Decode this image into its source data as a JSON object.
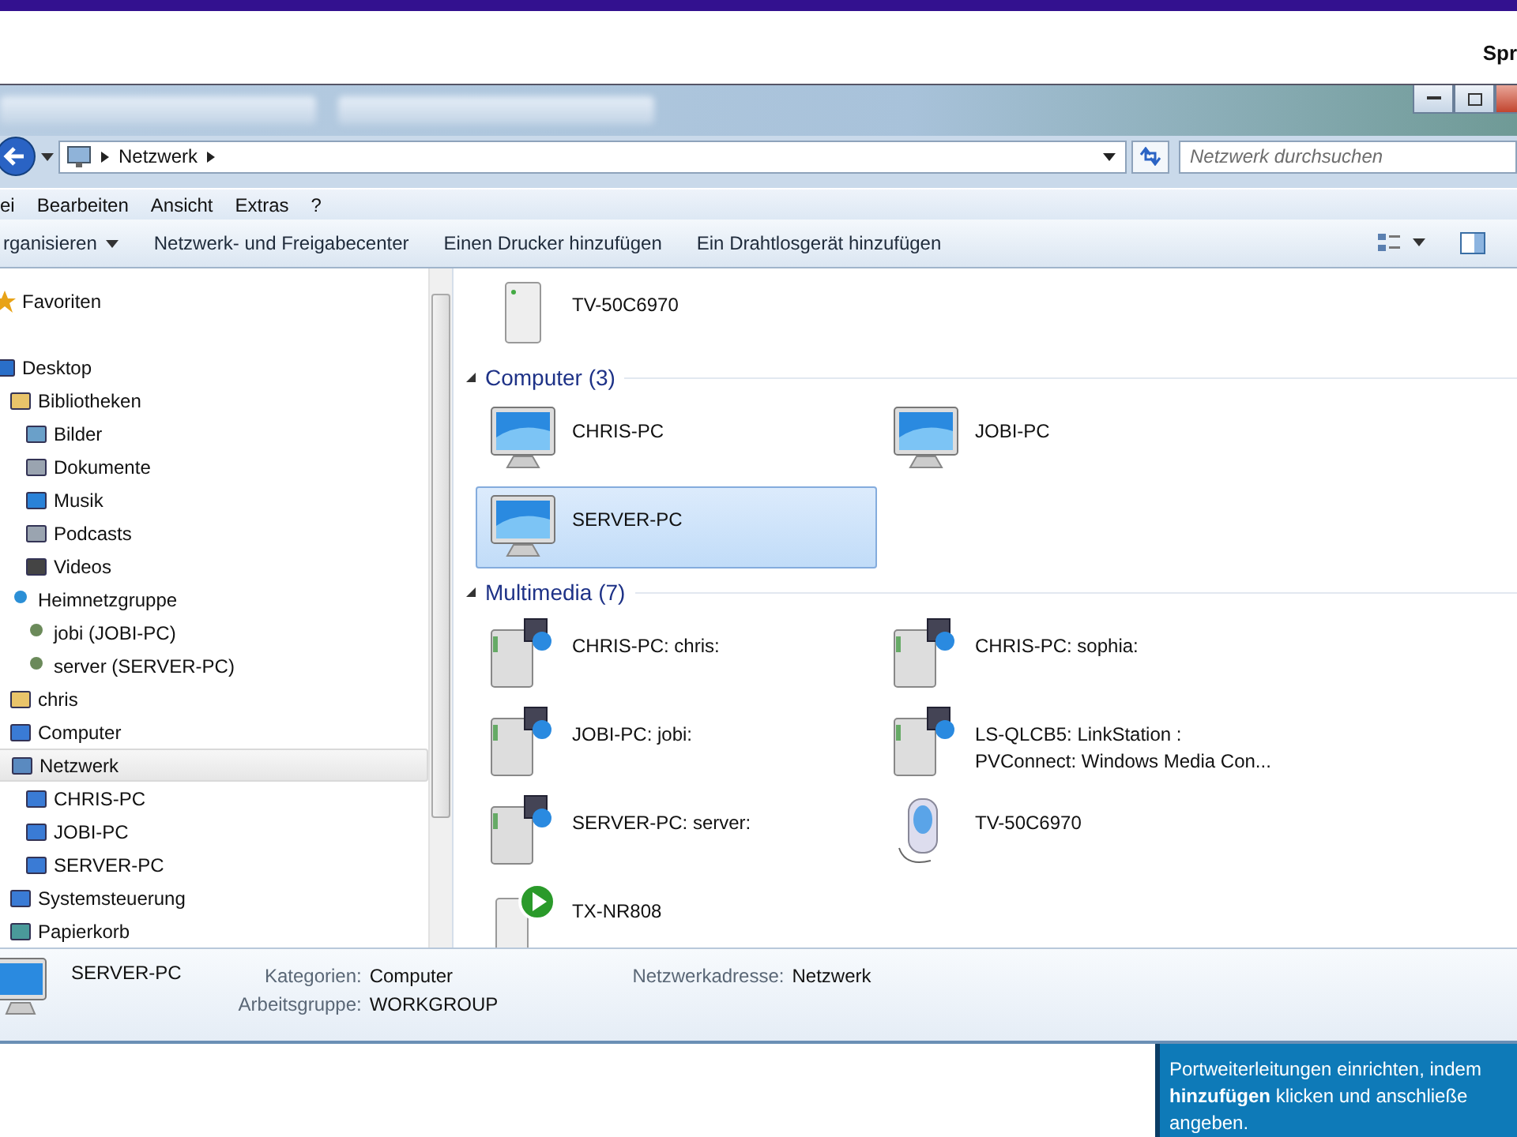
{
  "top_bar": {
    "text": "Spr"
  },
  "address": {
    "crumbs": [
      "Netzwerk"
    ],
    "search": {
      "placeholder": "Netzwerk durchsuchen"
    }
  },
  "menu": [
    "ei",
    "Bearbeiten",
    "Ansicht",
    "Extras",
    "?"
  ],
  "toolbar": [
    {
      "label": "rganisieren",
      "dropdown": true
    },
    {
      "label": "Netzwerk- und Freigabecenter",
      "dropdown": false
    },
    {
      "label": "Einen Drucker hinzufügen",
      "dropdown": false
    },
    {
      "label": "Ein Drahtlosgerät hinzufügen",
      "dropdown": false
    }
  ],
  "sidebar": {
    "items": [
      {
        "label": "Favoriten",
        "kind": "star",
        "selected": false
      },
      {
        "label": "Desktop",
        "kind": "desktop",
        "selected": false,
        "children": [
          {
            "label": "Bibliotheken",
            "kind": "folder",
            "selected": false,
            "children": [
              {
                "label": "Bilder",
                "kind": "picture",
                "selected": false
              },
              {
                "label": "Dokumente",
                "kind": "document",
                "selected": false
              },
              {
                "label": "Musik",
                "kind": "music",
                "selected": false
              },
              {
                "label": "Podcasts",
                "kind": "document",
                "selected": false
              },
              {
                "label": "Videos",
                "kind": "video",
                "selected": false
              }
            ]
          },
          {
            "label": "Heimnetzgruppe",
            "kind": "homegroup",
            "selected": false,
            "children": [
              {
                "label": "jobi (JOBI-PC)",
                "kind": "user",
                "selected": false
              },
              {
                "label": "server (SERVER-PC)",
                "kind": "user",
                "selected": false
              }
            ]
          },
          {
            "label": "chris",
            "kind": "folder",
            "selected": false
          },
          {
            "label": "Computer",
            "kind": "computer",
            "selected": false
          },
          {
            "label": "Netzwerk",
            "kind": "network",
            "selected": true,
            "children": [
              {
                "label": "CHRIS-PC",
                "kind": "computer",
                "selected": false
              },
              {
                "label": "JOBI-PC",
                "kind": "computer",
                "selected": false
              },
              {
                "label": "SERVER-PC",
                "kind": "computer",
                "selected": false
              }
            ]
          },
          {
            "label": "Systemsteuerung",
            "kind": "computer",
            "selected": false
          },
          {
            "label": "Papierkorb",
            "kind": "trash",
            "selected": false
          }
        ]
      }
    ]
  },
  "content": {
    "loose_items": [
      {
        "label": "TV-50C6970",
        "kind": "tower",
        "selected": false
      }
    ],
    "groups": [
      {
        "title": "Computer (3)",
        "items": [
          {
            "label": "CHRIS-PC",
            "kind": "monitor",
            "selected": false
          },
          {
            "label": "JOBI-PC",
            "kind": "monitor",
            "selected": false
          },
          {
            "label": "SERVER-PC",
            "kind": "monitor",
            "selected": true
          }
        ]
      },
      {
        "title": "Multimedia (7)",
        "items": [
          {
            "label": "CHRIS-PC: chris:",
            "kind": "media",
            "selected": false
          },
          {
            "label": "CHRIS-PC: sophia:",
            "kind": "media",
            "selected": false
          },
          {
            "label": "JOBI-PC: jobi:",
            "kind": "media",
            "selected": false
          },
          {
            "label": "LS-QLCB5: LinkStation :\nPVConnect: Windows Media Con...",
            "kind": "media",
            "selected": false
          },
          {
            "label": "SERVER-PC: server:",
            "kind": "media",
            "selected": false
          },
          {
            "label": "TV-50C6970",
            "kind": "phone",
            "selected": false
          },
          {
            "label": "TX-NR808",
            "kind": "player",
            "selected": false
          }
        ]
      }
    ]
  },
  "details": {
    "name": "SERVER-PC",
    "fields": [
      {
        "label": "Kategorien:",
        "value": "Computer"
      },
      {
        "label": "Arbeitsgruppe:",
        "value": "WORKGROUP"
      },
      {
        "label": "Netzwerkadresse:",
        "value": "Netzwerk"
      }
    ]
  },
  "info_box": {
    "lines": [
      "Portweiterleitungen einrichten, indem",
      "**hinzufügen** klicken und anschließe",
      "angeben."
    ]
  }
}
